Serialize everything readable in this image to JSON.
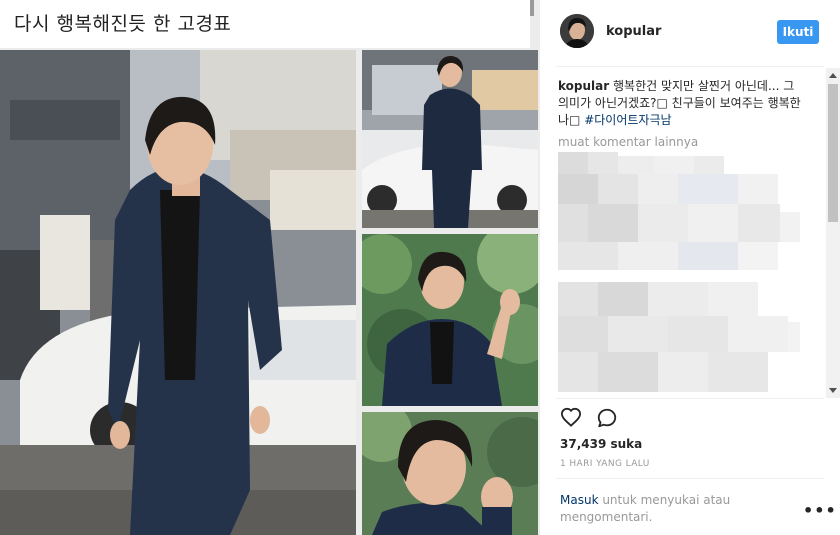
{
  "article": {
    "title": "다시 행복해진듯 한 고경표"
  },
  "post": {
    "username": "kopular",
    "follow_label": "Ikuti",
    "caption_user": "kopular",
    "caption_text": " 행복한건 맞지만 살찐거 아닌데... 그 의미가 아닌거겠죠?□ 친구들이 보여주는 행복한 나□ ",
    "caption_hashtag": "#다이어트자극남",
    "load_more_label": "muat komentar lainnya",
    "likes": "37,439 suka",
    "time": "1 HARI YANG LALU",
    "login_link": "Masuk",
    "login_rest": " untuk menyukai atau mengomentari.",
    "more_label": "•••"
  },
  "icons": {
    "like": "heart-outline-icon",
    "comment": "speech-bubble-icon",
    "more": "more-options-icon"
  },
  "colors": {
    "accent": "#3897f0",
    "link": "#003569",
    "muted": "#999999"
  }
}
